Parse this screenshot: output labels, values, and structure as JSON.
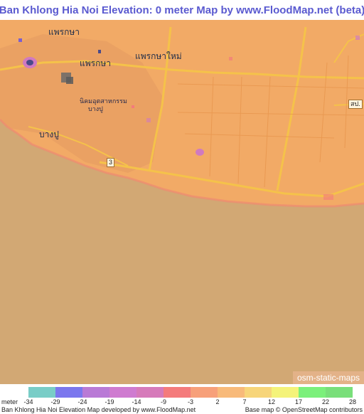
{
  "header": {
    "title": "Ban Khlong Hia Noi Elevation: 0 meter Map by www.FloodMap.net (beta)"
  },
  "map": {
    "place_labels": [
      {
        "text": "แพรกษา",
        "name": "label-phraek-sa-north"
      },
      {
        "text": "แพรกษา",
        "name": "label-phraek-sa"
      },
      {
        "text": "แพรกษาใหม่",
        "name": "label-phraek-sa-mai"
      },
      {
        "text": "นิคมอุตสาหกรรม",
        "name": "label-industrial-estate-1"
      },
      {
        "text": "บางปู",
        "name": "label-industrial-estate-2"
      },
      {
        "text": "บางปู",
        "name": "label-bang-pu"
      }
    ],
    "road_shields": [
      "3",
      "สป."
    ],
    "attribution_box": "osm-static-maps",
    "colors": {
      "land": "#f2aa66",
      "sea": "#d2a874",
      "road": "#f5c24a",
      "low_purple": "#7b5fd0",
      "low_pink": "#d07ac0"
    }
  },
  "legend": {
    "unit": "meter",
    "ticks": [
      "-34",
      "-29",
      "-24",
      "-19",
      "-14",
      "-9",
      "-3",
      "2",
      "7",
      "12",
      "17",
      "22",
      "28"
    ],
    "colors": [
      "#79cdc7",
      "#7b77ee",
      "#b97ad6",
      "#cf7bd0",
      "#d67aba",
      "#f47b7c",
      "#f7a07a",
      "#f8ba7a",
      "#f7d57a",
      "#f4f37a",
      "#7bf07b",
      "#79df7a"
    ],
    "footer_left": "Ban Khlong Hia Noi Elevation Map developed by www.FloodMap.net",
    "footer_right": "Base map © OpenStreetMap contributors"
  }
}
